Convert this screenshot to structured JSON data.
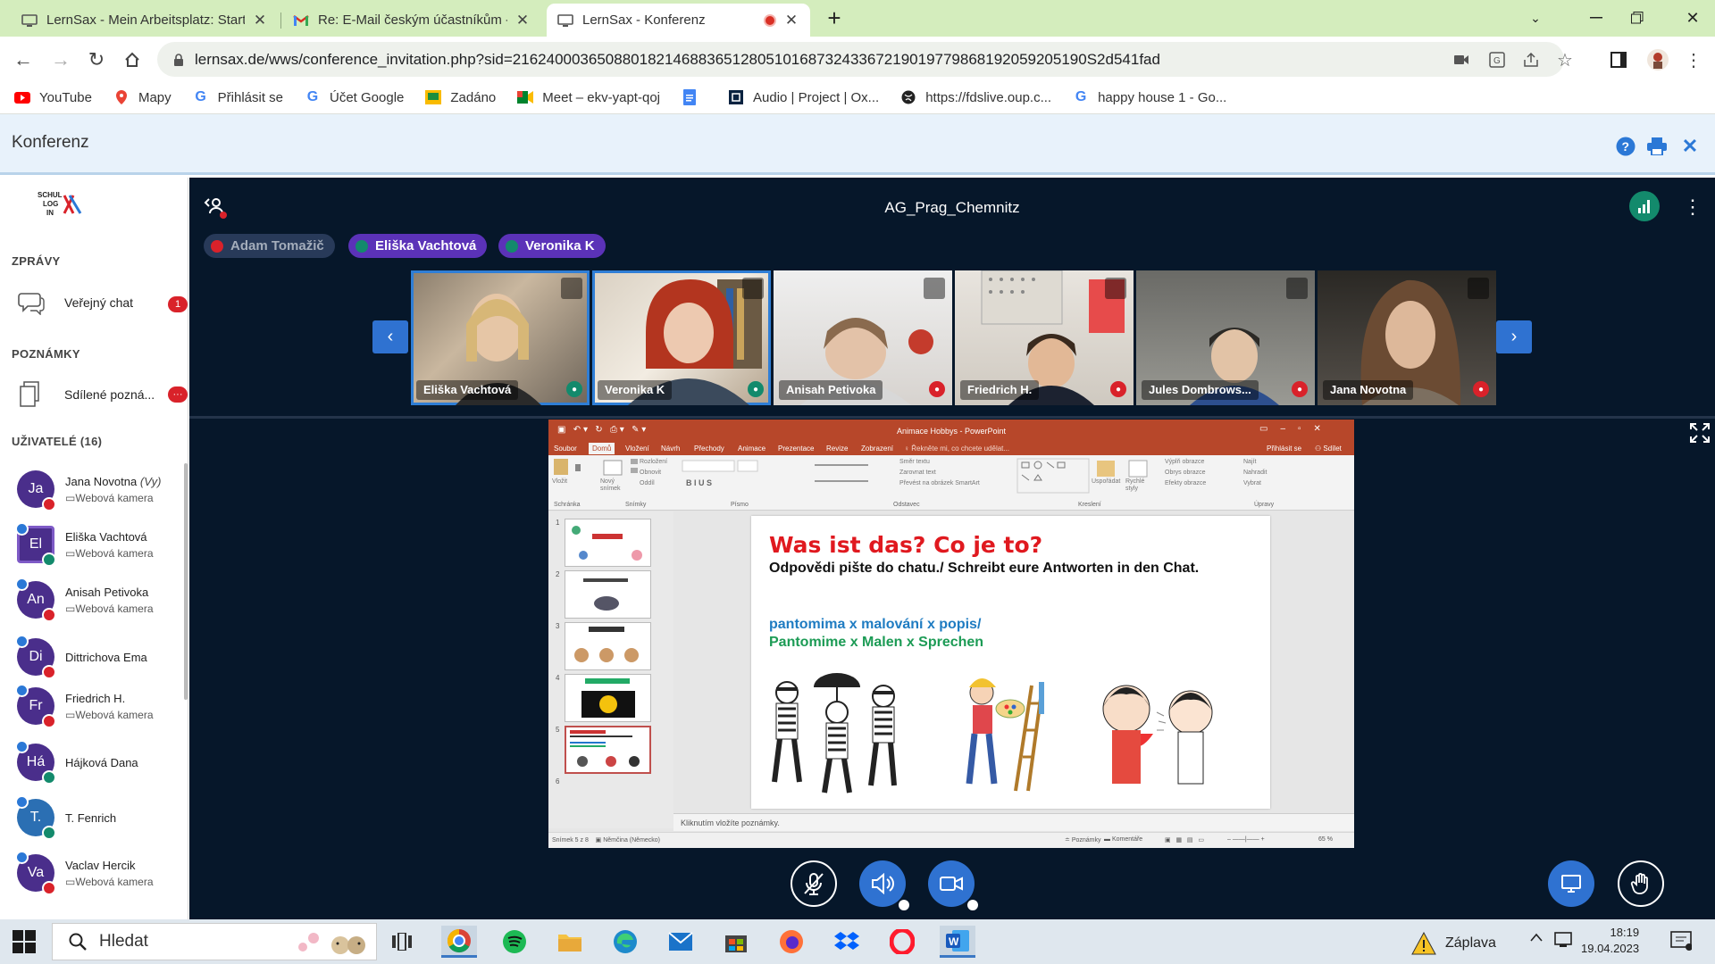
{
  "browser": {
    "tabs": [
      {
        "title": "LernSax - Mein Arbeitsplatz: Start",
        "active": false
      },
      {
        "title": "Re: E-Mail českým účastníkům - r",
        "active": false
      },
      {
        "title": "LernSax - Konferenz",
        "active": true
      }
    ],
    "url": "lernsax.de/wws/conference_invitation.php?sid=21624000365088018214688365128051016873243367219019779868192059205190S2d541fad",
    "bookmarks": [
      {
        "label": "YouTube",
        "icon": "youtube-icon"
      },
      {
        "label": "Mapy",
        "icon": "maps-pin-icon"
      },
      {
        "label": "Přihlásit se",
        "icon": "google-icon"
      },
      {
        "label": "Účet Google",
        "icon": "google-icon"
      },
      {
        "label": "Zadáno",
        "icon": "classroom-icon"
      },
      {
        "label": "Meet – ekv-yapt-qoj",
        "icon": "meet-icon"
      },
      {
        "label": "",
        "icon": "docs-icon"
      },
      {
        "label": "Audio | Project | Ox...",
        "icon": "oxford-icon"
      },
      {
        "label": "https://fdslive.oup.c...",
        "icon": "globe-icon"
      },
      {
        "label": "happy house 1 - Go...",
        "icon": "google-icon"
      }
    ]
  },
  "app": {
    "title": "Konferenz"
  },
  "sidebar": {
    "sections": {
      "messages": "ZPRÁVY",
      "notes": "POZNÁMKY",
      "users": "UŽIVATELÉ (16)"
    },
    "public_chat": {
      "label": "Veřejný chat",
      "badge": "1"
    },
    "shared_notes": {
      "label": "Sdílené pozná...",
      "badge": "···"
    },
    "users": [
      {
        "initials": "Ja",
        "name": "Jana Novotna",
        "you": "(Vy)",
        "sub": "Webová kamera",
        "mic": "red",
        "square": false,
        "badge": false
      },
      {
        "initials": "El",
        "name": "Eliška Vachtová",
        "you": "",
        "sub": "Webová kamera",
        "mic": "green",
        "square": true,
        "badge": true
      },
      {
        "initials": "An",
        "name": "Anisah Petivoka",
        "you": "",
        "sub": "Webová kamera",
        "mic": "red",
        "square": false,
        "badge": true
      },
      {
        "initials": "Di",
        "name": "Dittrichova Ema",
        "you": "",
        "sub": "",
        "mic": "red",
        "square": false,
        "badge": true
      },
      {
        "initials": "Fr",
        "name": "Friedrich H.",
        "you": "",
        "sub": "Webová kamera",
        "mic": "red",
        "square": false,
        "badge": true
      },
      {
        "initials": "Há",
        "name": "Hájková Dana",
        "you": "",
        "sub": "",
        "mic": "green",
        "square": false,
        "badge": true
      },
      {
        "initials": "T.",
        "name": "T. Fenrich",
        "you": "",
        "sub": "",
        "mic": "green",
        "square": false,
        "badge": true
      },
      {
        "initials": "Va",
        "name": "Vaclav Hercik",
        "you": "",
        "sub": "Webová kamera",
        "mic": "red",
        "square": false,
        "badge": true
      }
    ]
  },
  "conference": {
    "room_name": "AG_Prag_Chemnitz",
    "talkers": [
      {
        "name": "Adam Tomažič",
        "muted": true
      },
      {
        "name": "Eliška Vachtová",
        "muted": false
      },
      {
        "name": "Veronika K",
        "muted": false
      }
    ],
    "videos": [
      {
        "name": "Eliška Vachtová",
        "mic": "green",
        "talking": true
      },
      {
        "name": "Veronika K",
        "mic": "green",
        "talking": true
      },
      {
        "name": "Anisah Petivoka",
        "mic": "red",
        "talking": false
      },
      {
        "name": "Friedrich H.",
        "mic": "red",
        "talking": false
      },
      {
        "name": "Jules Dombrows...",
        "mic": "red",
        "talking": false
      },
      {
        "name": "Jana Novotna",
        "mic": "red",
        "talking": false
      }
    ]
  },
  "presentation": {
    "window_title": "Animace Hobbys - PowerPoint",
    "menu": [
      "Soubor",
      "Domů",
      "Vložení",
      "Návrh",
      "Přechody",
      "Animace",
      "Prezentace",
      "Revize",
      "Zobrazení"
    ],
    "search_hint": "Řekněte mi, co chcete udělat...",
    "signin": "Přihlásit se",
    "share": "Sdílet",
    "ribbon_groups": [
      "Schránka",
      "Snímky",
      "Písmo",
      "Odstavec",
      "Kreslení",
      "Úpravy"
    ],
    "ribbon_labels": [
      "Vložit",
      "Nový snímek",
      "Rozložení",
      "Obnovit",
      "Oddíl",
      "Směr textu",
      "Zarovnat text",
      "Převést na obrázek SmartArt",
      "Uspořádat",
      "Rychlé styly",
      "Výplň obrazce",
      "Obrys obrazce",
      "Efekty obrazce",
      "Najít",
      "Nahradit",
      "Vybrat"
    ],
    "thumbnail_numbers": [
      "1",
      "2",
      "3",
      "4",
      "5",
      "6"
    ],
    "slide": {
      "title": "Was ist das? Co je to?",
      "instruction": "Odpovědi pište do chatu./ Schreibt eure Antworten in den Chat.",
      "line_cz": "pantomima x malování x popis/",
      "line_de": "Pantomime x Malen x Sprechen"
    },
    "notes_placeholder": "Kliknutím vložíte poznámky.",
    "status_left": "Snímek 5 z 8",
    "status_lang": "Němčina (Německo)",
    "status_notes": "Poznámky",
    "status_comments": "Komentáře",
    "zoom": "65 %"
  },
  "taskbar": {
    "search_placeholder": "Hledat",
    "weather": "Záplava",
    "time": "18:19",
    "date": "19.04.2023"
  },
  "colors": {
    "conference_bg": "#06172a",
    "accent_blue": "#2f72d1",
    "mic_green": "#138a6c",
    "mic_red": "#d9222a",
    "talker_purple": "#5b32b8",
    "ppt_orange": "#b7472a"
  }
}
